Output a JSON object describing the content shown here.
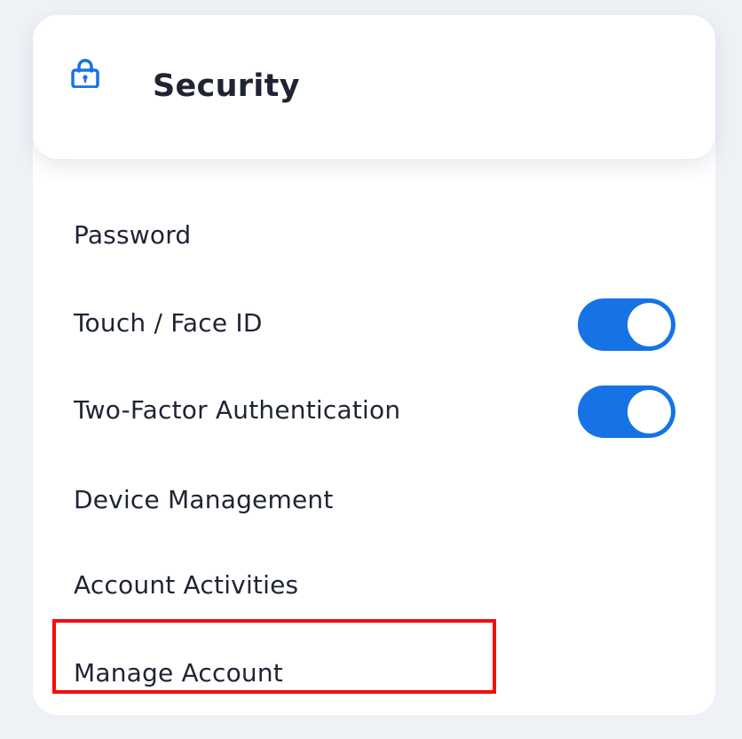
{
  "header": {
    "icon": "lock-icon",
    "title": "Security"
  },
  "items": [
    {
      "label": "Password",
      "toggle": null
    },
    {
      "label": "Touch / Face ID",
      "toggle": true
    },
    {
      "label": "Two-Factor Authentication",
      "toggle": true
    },
    {
      "label": "Device Management",
      "toggle": null
    },
    {
      "label": "Account Activities",
      "toggle": null
    },
    {
      "label": "Manage Account",
      "toggle": null,
      "highlighted": true
    }
  ],
  "colors": {
    "background": "#eef2f6",
    "card": "#ffffff",
    "accent": "#1673e6",
    "text": "#1e2433",
    "highlight": "#f20d0d"
  }
}
